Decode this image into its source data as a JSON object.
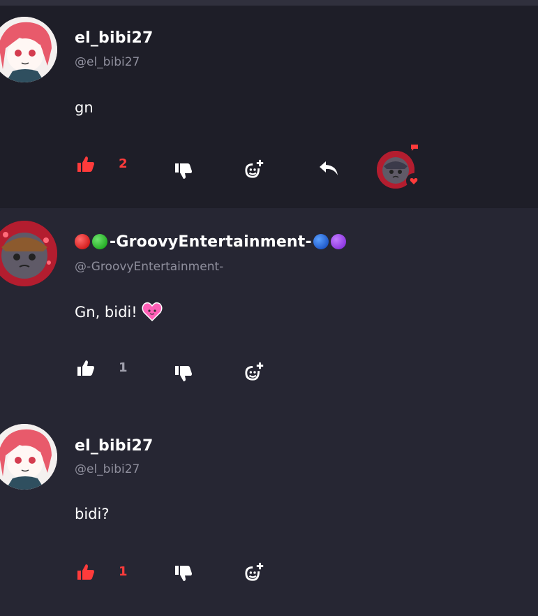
{
  "comments": [
    {
      "username": "el_bibi27",
      "handle": "@el_bibi27",
      "text": "gn",
      "likes": "2",
      "liked": true,
      "reply_label": "reply-icon",
      "reactions": [
        "speech-bubble-badge",
        "heart-badge"
      ]
    },
    {
      "username": "-GroovyEntertainment-",
      "handle": "@-GroovyEntertainment-",
      "text": "Gn, bidi!",
      "likes": "1",
      "liked": false,
      "emojis_before": [
        "red-circle",
        "green-circle"
      ],
      "emojis_after": [
        "blue-circle",
        "purple-circle"
      ],
      "text_emoji": "pink-heart-face"
    },
    {
      "username": "el_bibi27",
      "handle": "@el_bibi27",
      "text": "bidi?",
      "likes": "1",
      "liked": true
    }
  ],
  "colors": {
    "like_active": "#ff3b3b",
    "background": "#262633",
    "highlight_background": "#1e1e28",
    "handle": "#8e8e9c"
  }
}
